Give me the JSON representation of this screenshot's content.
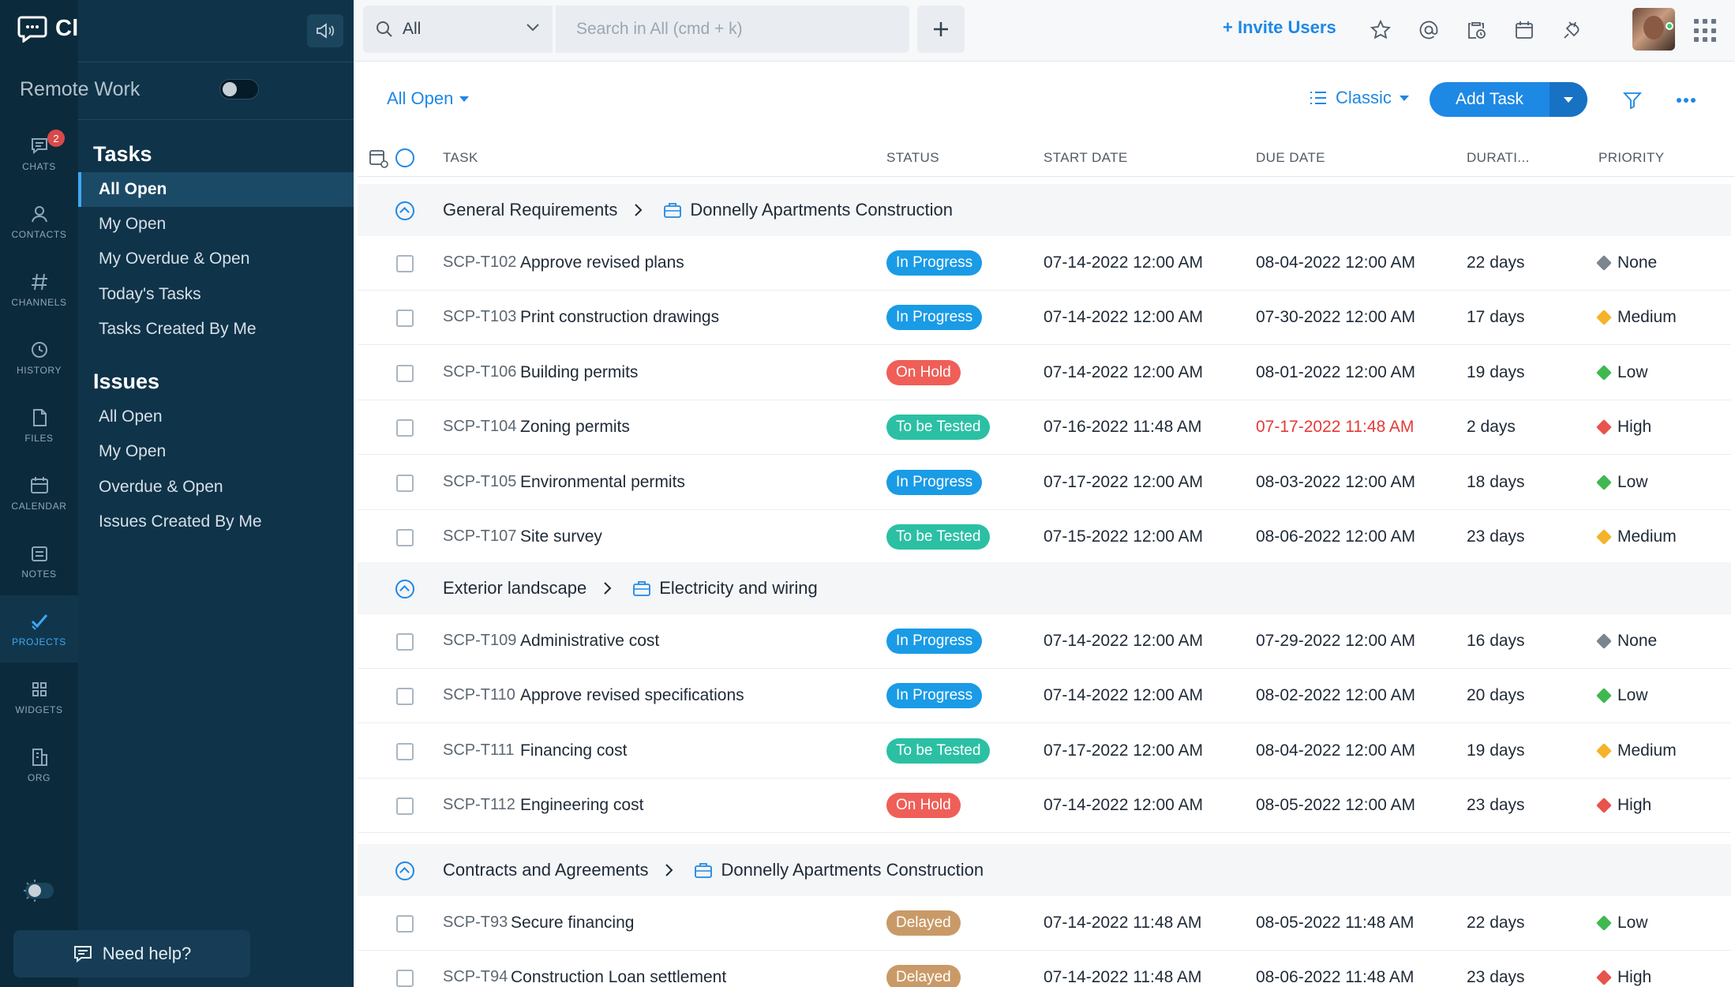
{
  "app": {
    "name": "Cliq"
  },
  "rail": {
    "items": [
      {
        "label": "CHATS",
        "badge": "2"
      },
      {
        "label": "CONTACTS"
      },
      {
        "label": "CHANNELS"
      },
      {
        "label": "HISTORY"
      },
      {
        "label": "FILES"
      },
      {
        "label": "CALENDAR"
      },
      {
        "label": "NOTES"
      },
      {
        "label": "PROJECTS"
      },
      {
        "label": "WIDGETS"
      },
      {
        "label": "ORG"
      }
    ]
  },
  "workspace": {
    "name": "Remote Work"
  },
  "sidebar": {
    "tasks_heading": "Tasks",
    "tasks": [
      "All Open",
      "My Open",
      "My Overdue & Open",
      "Today's Tasks",
      "Tasks Created By Me"
    ],
    "issues_heading": "Issues",
    "issues": [
      "All Open",
      "My Open",
      "Overdue & Open",
      "Issues Created By Me"
    ],
    "help": "Need help?"
  },
  "topbar": {
    "scope": "All",
    "search_placeholder": "Search in All (cmd + k)",
    "invite": "+ Invite Users"
  },
  "toolbar": {
    "filter": "All Open",
    "view": "Classic",
    "add_task": "Add Task"
  },
  "colors": {
    "accent": "#1e88e5",
    "in_progress": "#1a9be6",
    "on_hold": "#ef5f58",
    "to_be_tested": "#2bc0a4",
    "delayed": "#c99a67",
    "prio_none": "#7b8590",
    "prio_low": "#3fb94f",
    "prio_medium": "#f5b32a",
    "prio_high": "#e8534b"
  },
  "table": {
    "headers": {
      "task": "TASK",
      "status": "STATUS",
      "start": "START DATE",
      "due": "DUE DATE",
      "duration": "DURATI...",
      "priority": "PRIORITY"
    },
    "groups": [
      {
        "name": "General Requirements",
        "project": "Donnelly Apartments Construction",
        "rows": [
          {
            "id": "SCP-T102",
            "name": "Approve revised plans",
            "status": "In Progress",
            "start": "07-14-2022 12:00 AM",
            "due": "08-04-2022 12:00 AM",
            "duration": "22 days",
            "priority": "None"
          },
          {
            "id": "SCP-T103",
            "name": "Print construction drawings",
            "status": "In Progress",
            "start": "07-14-2022 12:00 AM",
            "due": "07-30-2022 12:00 AM",
            "duration": "17 days",
            "priority": "Medium"
          },
          {
            "id": "SCP-T106",
            "name": "Building permits",
            "status": "On Hold",
            "start": "07-14-2022 12:00 AM",
            "due": "08-01-2022 12:00 AM",
            "duration": "19 days",
            "priority": "Low"
          },
          {
            "id": "SCP-T104",
            "name": "Zoning permits",
            "status": "To be Tested",
            "start": "07-16-2022 11:48 AM",
            "due": "07-17-2022 11:48 AM",
            "duration": "2 days",
            "priority": "High",
            "overdue": true
          },
          {
            "id": "SCP-T105",
            "name": "Environmental permits",
            "status": "In Progress",
            "start": "07-17-2022 12:00 AM",
            "due": "08-03-2022 12:00 AM",
            "duration": "18 days",
            "priority": "Low"
          },
          {
            "id": "SCP-T107",
            "name": "Site survey",
            "status": "To be Tested",
            "start": "07-15-2022 12:00 AM",
            "due": "08-06-2022 12:00 AM",
            "duration": "23 days",
            "priority": "Medium"
          }
        ]
      },
      {
        "name": "Exterior landscape",
        "project": "Electricity and wiring",
        "rows": [
          {
            "id": "SCP-T109",
            "name": "Administrative cost",
            "status": "In Progress",
            "start": "07-14-2022 12:00 AM",
            "due": "07-29-2022 12:00 AM",
            "duration": "16 days",
            "priority": "None"
          },
          {
            "id": "SCP-T110",
            "name": "Approve revised specifications",
            "status": "In Progress",
            "start": "07-14-2022 12:00 AM",
            "due": "08-02-2022 12:00 AM",
            "duration": "20 days",
            "priority": "Low"
          },
          {
            "id": "SCP-T111",
            "name": "Financing cost",
            "status": "To be Tested",
            "start": "07-17-2022 12:00 AM",
            "due": "08-04-2022 12:00 AM",
            "duration": "19 days",
            "priority": "Medium"
          },
          {
            "id": "SCP-T112",
            "name": "Engineering cost",
            "status": "On Hold",
            "start": "07-14-2022 12:00 AM",
            "due": "08-05-2022 12:00 AM",
            "duration": "23 days",
            "priority": "High"
          }
        ]
      },
      {
        "name": "Contracts and Agreements",
        "project": "Donnelly Apartments Construction",
        "rows": [
          {
            "id": "SCP-T93",
            "name": "Secure financing",
            "status": "Delayed",
            "start": "07-14-2022 11:48 AM",
            "due": "08-05-2022 11:48 AM",
            "duration": "22 days",
            "priority": "Low"
          },
          {
            "id": "SCP-T94",
            "name": "Construction Loan settlement",
            "status": "Delayed",
            "start": "07-14-2022 11:48 AM",
            "due": "08-06-2022 11:48 AM",
            "duration": "23 days",
            "priority": "High"
          }
        ]
      }
    ]
  }
}
